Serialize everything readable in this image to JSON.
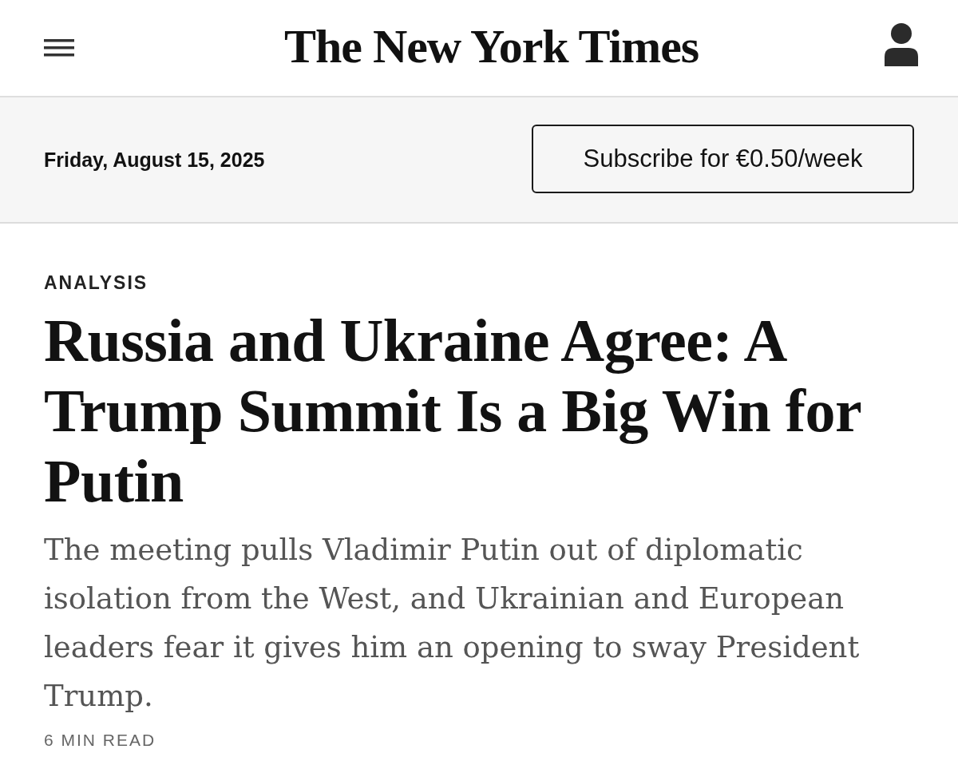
{
  "header": {
    "logo": "The New York Times"
  },
  "date_bar": {
    "date": "Friday, August 15, 2025",
    "subscribe_button": "Subscribe for €0.50/week"
  },
  "article": {
    "kicker": "ANALYSIS",
    "headline": "Russia and Ukraine Agree: A Trump Summit Is a Big Win for Putin",
    "summary": "The meeting pulls Vladimir Putin out of diplomatic isolation from the West, and Ukrainian and European leaders fear it gives him an opening to sway President Trump.",
    "read_time": "6 MIN READ"
  }
}
